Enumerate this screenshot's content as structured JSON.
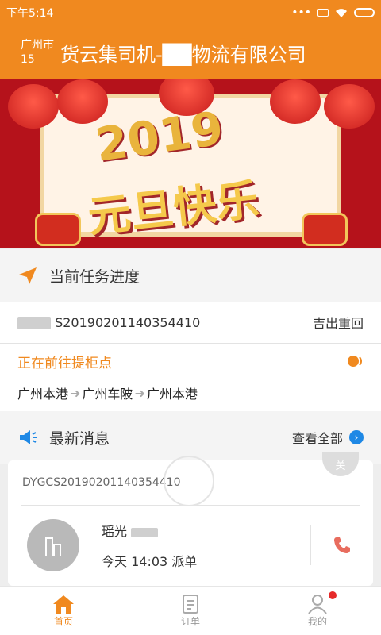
{
  "status": {
    "time": "下午5:14"
  },
  "header": {
    "city": "广州市",
    "city_sub": "15",
    "title": "货云集司机-██物流有限公司"
  },
  "banner": {
    "year": "2019",
    "text": "元旦快乐"
  },
  "task": {
    "section_title": "当前任务进度",
    "order_no": "S20190201140354410",
    "order_action": "吉出重回",
    "status_text": "正在前往提柜点",
    "route": [
      "广州本港",
      "广州车陂",
      "广州本港"
    ]
  },
  "news": {
    "section_title": "最新消息",
    "view_all": "查看全部",
    "card_order_no": "DYGCS20190201140354410",
    "close_label": "关",
    "driver_name": "瑶光",
    "dispatch_time": "今天 14:03 派单"
  },
  "tabs": [
    {
      "label": "首页"
    },
    {
      "label": "订单"
    },
    {
      "label": "我的"
    }
  ],
  "colors": {
    "accent": "#f0891f",
    "phone": "#e86c5e"
  }
}
